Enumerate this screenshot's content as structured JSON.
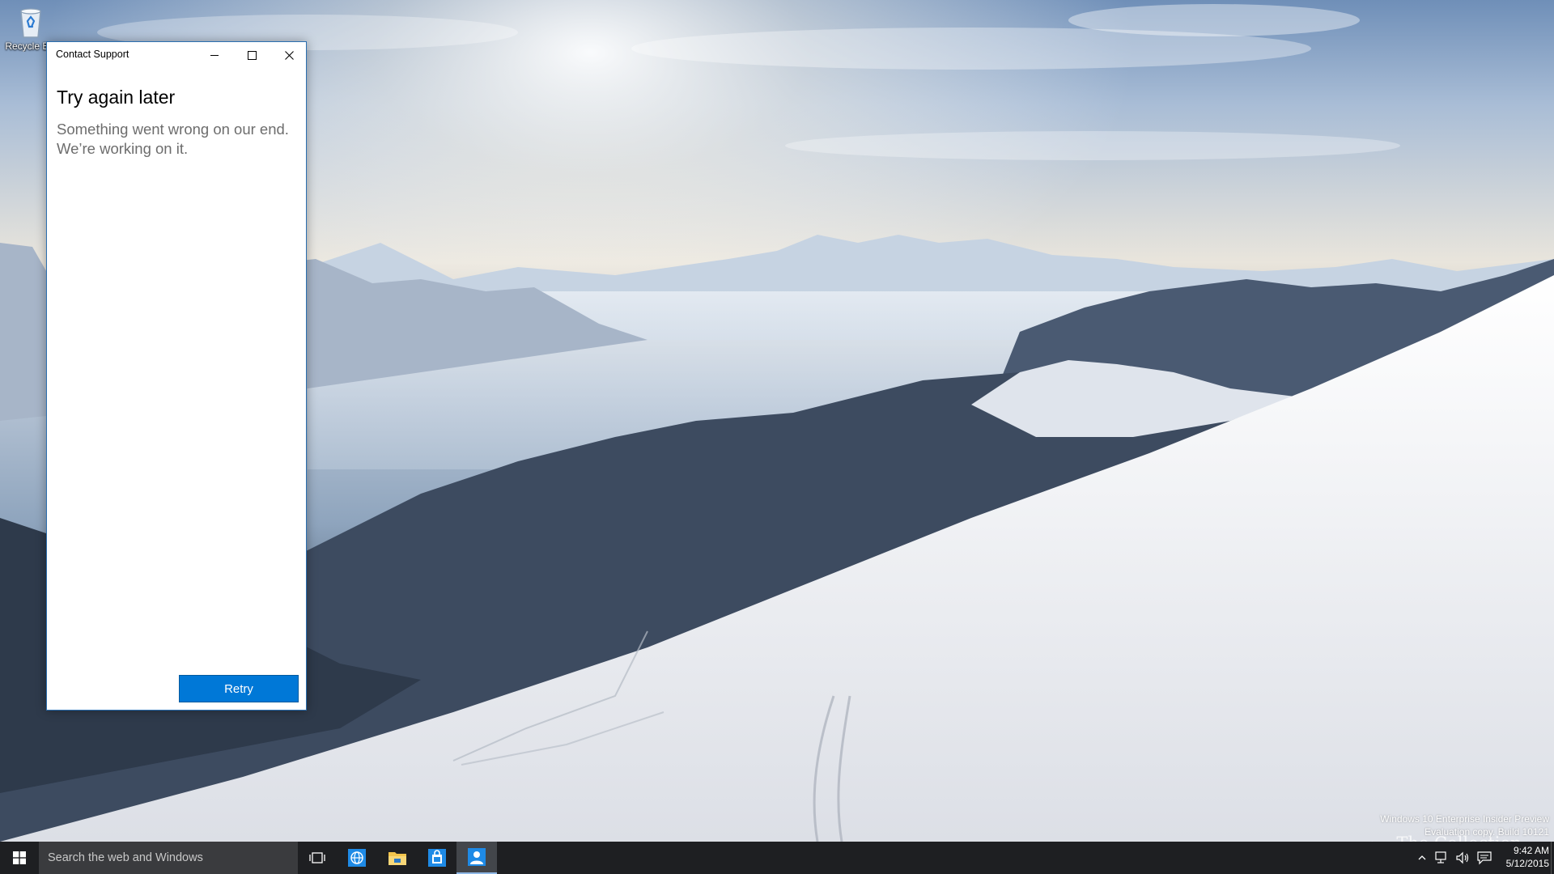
{
  "desktop": {
    "recycle_bin_label": "Recycle Bin"
  },
  "window": {
    "title": "Contact Support",
    "heading": "Try again later",
    "message": "Something went wrong on our end. We’re working on it.",
    "retry_label": "Retry"
  },
  "watermark": {
    "line1": "Windows 10 Enterprise Insider Preview",
    "line2": "Evaluation copy. Build 10121"
  },
  "brand": {
    "text": "The Collection Book"
  },
  "taskbar": {
    "search_placeholder": "Search the web and Windows",
    "pinned_apps": [
      "internet-explorer",
      "file-explorer",
      "store",
      "contact-support"
    ],
    "time": "9:42 AM",
    "date": "5/12/2015"
  },
  "colors": {
    "accent": "#0078d7",
    "taskbar": "#1e1f22",
    "search_box": "#3a3b3e"
  }
}
